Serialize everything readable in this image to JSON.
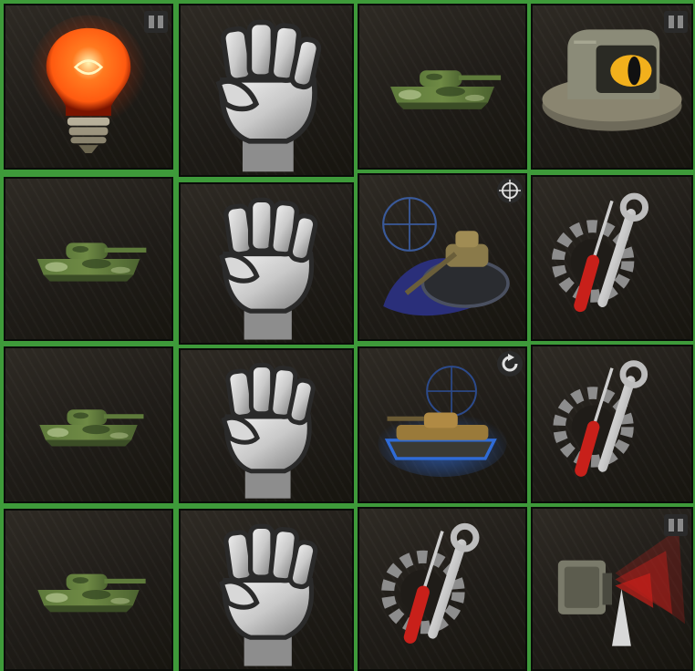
{
  "grid": {
    "rows": [
      [
        "lightbulb-icon",
        "fist-icon",
        "camo-tank-icon",
        "binocular-bunker-icon"
      ],
      [
        "camo-tank-icon",
        "fist-icon",
        "target-tank-icon",
        "repair-tools-icon"
      ],
      [
        "camo-tank-icon",
        "fist-icon",
        "blue-tank-icon",
        "repair-tools-icon"
      ],
      [
        "camo-tank-icon",
        "fist-icon",
        "repair-tools-icon",
        "radio-signal-icon"
      ]
    ],
    "corner_badges": {
      "0-0": "stack-badge-icon",
      "0-3": "stack-badge-icon",
      "1-2": "crosshair-badge-icon",
      "2-2": "refresh-badge-icon",
      "3-3": "stack-badge-icon"
    }
  },
  "colors": {
    "frame_green": "#3e9a3a",
    "cell_dark": "#1f1c18",
    "bulb_glow": "#ff5a10",
    "camo_green": "#6f8a45",
    "steel": "#c9c9c9",
    "tool_red": "#c8201a",
    "blue_glow": "#2f6bd6"
  }
}
